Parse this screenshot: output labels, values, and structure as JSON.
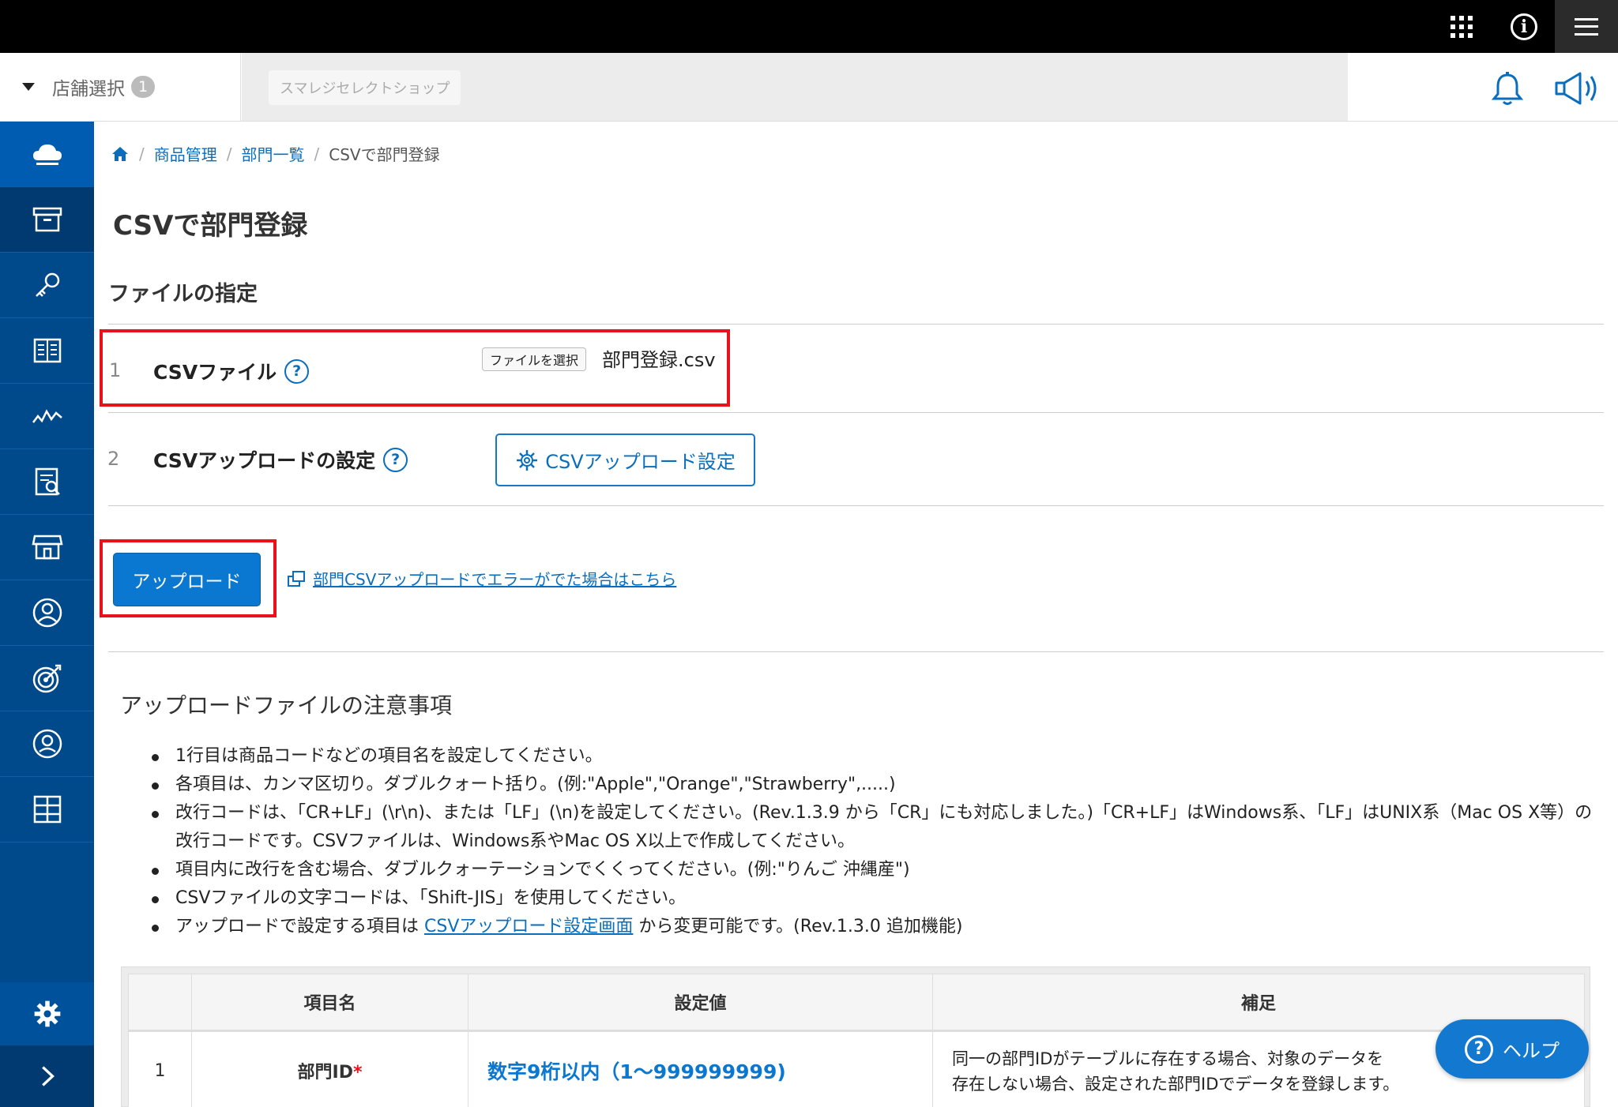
{
  "header": {
    "store_select_label": "店舗選択",
    "store_count": "1",
    "shop_name": "スマレジセレクトショップ"
  },
  "breadcrumb": {
    "items": [
      "商品管理",
      "部門一覧"
    ],
    "current": "CSVで部門登録"
  },
  "page": {
    "title": "CSVで部門登録",
    "section_title": "ファイルの指定"
  },
  "rows": [
    {
      "num": "1",
      "label": "CSVファイル",
      "file_button": "ファイルを選択",
      "file_name": "部門登録.csv"
    },
    {
      "num": "2",
      "label": "CSVアップロードの設定",
      "button": "CSVアップロード設定"
    }
  ],
  "help_mark": "?",
  "actions": {
    "upload": "アップロード",
    "error_link": "部門CSVアップロードでエラーがでた場合はこちら"
  },
  "notes": {
    "title": "アップロードファイルの注意事項",
    "items": [
      "1行目は商品コードなどの項目名を設定してください。",
      "各項目は、カンマ区切り。ダブルクォート括り。(例:\"Apple\",\"Orange\",\"Strawberry\",.....)",
      "改行コードは、「CR+LF」(\\r\\n)、または「LF」(\\n)を設定してください。(Rev.1.3.9 から「CR」にも対応しました。)「CR+LF」はWindows系、「LF」はUNIX系（Mac OS X等）の改行コードです。CSVファイルは、Windows系やMac OS X以上で作成してください。",
      "項目内に改行を含む場合、ダブルクォーテーションでくくってください。(例:\"りんご 沖縄産\")",
      "CSVファイルの文字コードは、「Shift-JIS」を使用してください。"
    ],
    "last_prefix": "アップロードで設定する項目は ",
    "last_link": "CSVアップロード設定画面",
    "last_suffix": " から変更可能です。(Rev.1.3.0 追加機能)"
  },
  "table": {
    "headers": [
      "",
      "項目名",
      "設定値",
      "補足"
    ],
    "rows": [
      {
        "num": "1",
        "name": "部門ID",
        "required_mark": "*",
        "value": "数字9桁以内（1〜999999999)",
        "note_line1": "同一の部門IDがテーブルに存在する場合、対象のデータを",
        "note_line2": "存在しない場合、設定された部門IDでデータを登録します。"
      }
    ]
  },
  "help_button": {
    "label": "ヘルプ",
    "mark": "?"
  },
  "colors": {
    "sidebar": "#004a8c",
    "accent": "#0a78d1",
    "highlight_box": "#e8121c"
  }
}
